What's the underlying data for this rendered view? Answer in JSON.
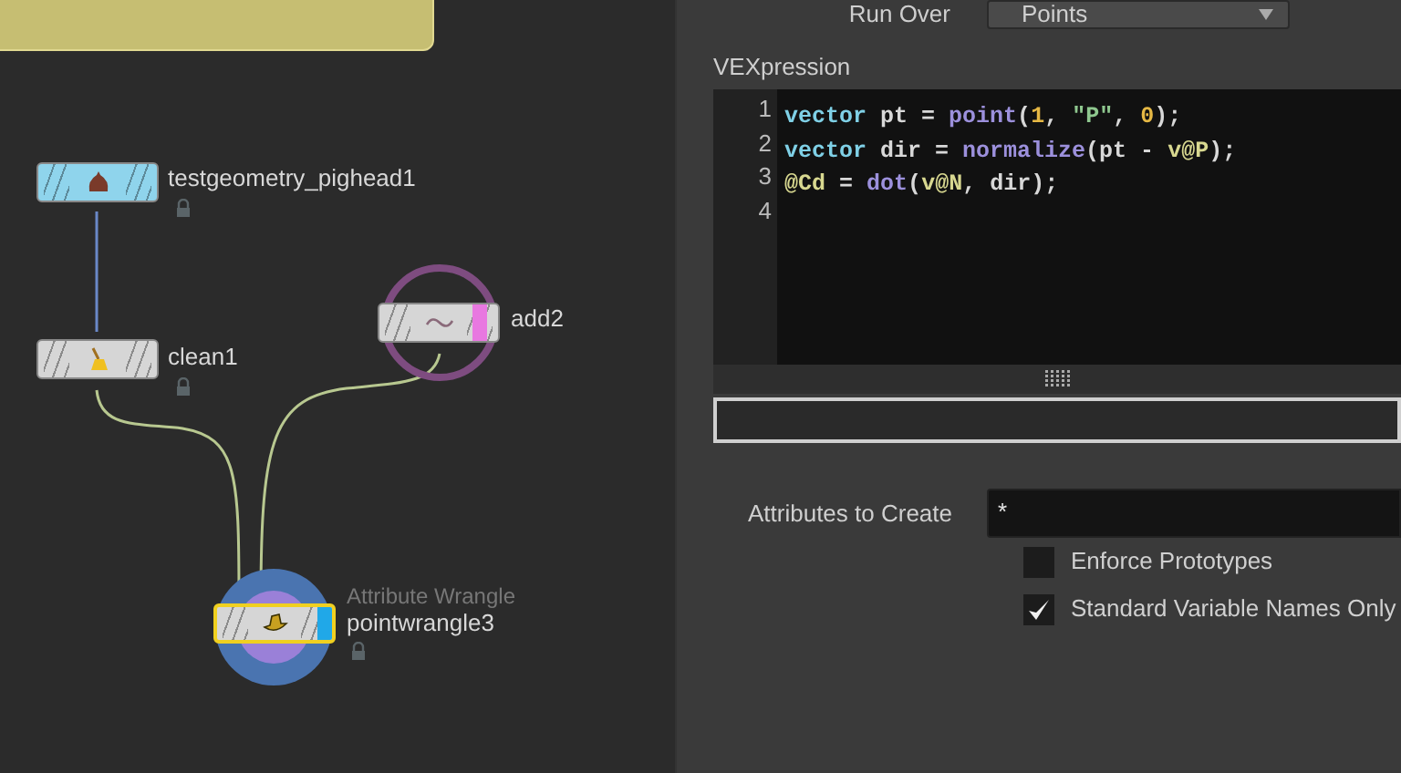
{
  "network": {
    "nodes": [
      {
        "name": "testgeometry_pighead1",
        "kind": "pighead",
        "color": "#8fd4ec",
        "locked": true,
        "selected": false
      },
      {
        "name": "clean1",
        "kind": "clean",
        "color": "#d6d6d6",
        "locked": true,
        "selected": false
      },
      {
        "name": "add2",
        "kind": "add",
        "color": "#d6d6d6",
        "locked": false,
        "selected": false
      },
      {
        "name": "pointwrangle3",
        "type_label": "Attribute Wrangle",
        "kind": "wrangle",
        "color": "#d6d6d6",
        "locked": true,
        "selected": true
      }
    ]
  },
  "parameters": {
    "run_over": {
      "label": "Run Over",
      "value": "Points"
    },
    "vexpression": {
      "label": "VEXpression",
      "lines": [
        {
          "number": "1",
          "tokens": [
            {
              "text": "vector",
              "kind": "keyword"
            },
            {
              "text": " pt = ",
              "kind": "plain"
            },
            {
              "text": "point",
              "kind": "func"
            },
            {
              "text": "(",
              "kind": "plain"
            },
            {
              "text": "1",
              "kind": "number"
            },
            {
              "text": ", ",
              "kind": "plain"
            },
            {
              "text": "\"P\"",
              "kind": "string"
            },
            {
              "text": ", ",
              "kind": "plain"
            },
            {
              "text": "0",
              "kind": "number"
            },
            {
              "text": ");",
              "kind": "plain"
            }
          ]
        },
        {
          "number": "2",
          "tokens": [
            {
              "text": "vector",
              "kind": "keyword"
            },
            {
              "text": " dir = ",
              "kind": "plain"
            },
            {
              "text": "normalize",
              "kind": "func"
            },
            {
              "text": "(pt - ",
              "kind": "plain"
            },
            {
              "text": "v@P",
              "kind": "attr"
            },
            {
              "text": ");",
              "kind": "plain"
            }
          ]
        },
        {
          "number": "3",
          "tokens": [
            {
              "text": "@Cd",
              "kind": "attr"
            },
            {
              "text": " = ",
              "kind": "plain"
            },
            {
              "text": "dot",
              "kind": "func"
            },
            {
              "text": "(",
              "kind": "plain"
            },
            {
              "text": "v@N",
              "kind": "attr"
            },
            {
              "text": ", dir);",
              "kind": "plain"
            }
          ]
        },
        {
          "number": "4"
        }
      ]
    },
    "attributes_to_create": {
      "label": "Attributes to Create",
      "value": "*"
    },
    "checkboxes": [
      {
        "label": "Enforce Prototypes",
        "checked": false
      },
      {
        "label": "Standard Variable Names Only",
        "checked": true
      }
    ]
  }
}
